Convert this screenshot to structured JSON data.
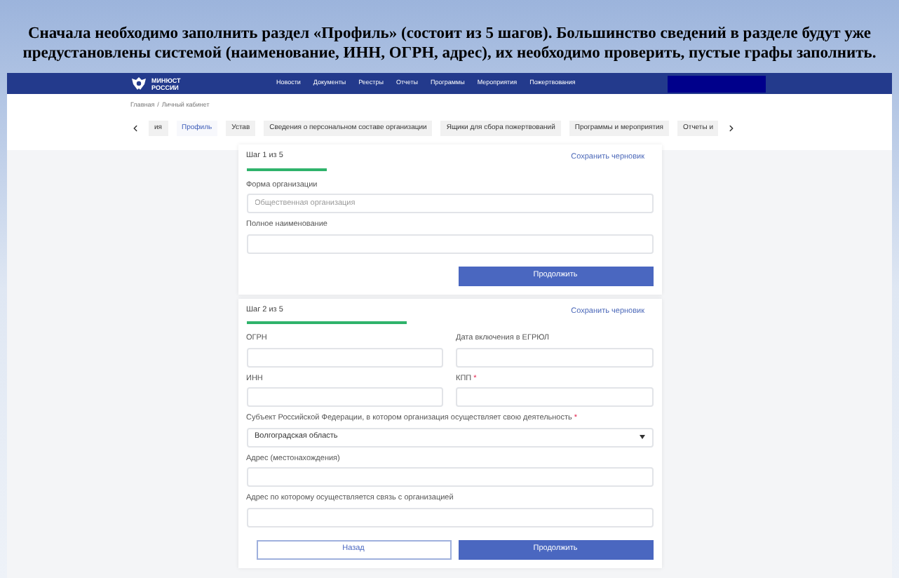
{
  "caption": "Сначала необходимо заполнить раздел «Профиль» (состоит из 5 шагов). Большинство сведений в разделе будут уже предустановлены системой (наименование, ИНН, ОГРН, адрес), их необходимо проверить, пустые графы заполнить.",
  "header": {
    "logo_lines": [
      "МИНЮСТ",
      "РОССИИ"
    ],
    "nav": [
      "Новости",
      "Документы",
      "Реестры",
      "Отчеты",
      "Программы",
      "Мероприятия",
      "Пожертвования"
    ]
  },
  "breadcrumb": {
    "items": [
      "Главная",
      "Личный кабинет"
    ],
    "separator": "/"
  },
  "tabs": [
    {
      "label": "ия",
      "selected": false
    },
    {
      "label": "Профиль",
      "selected": true
    },
    {
      "label": "Устав",
      "selected": false
    },
    {
      "label": "Сведения о персональном составе организации",
      "selected": false
    },
    {
      "label": "Ящики для сбора пожертвований",
      "selected": false
    },
    {
      "label": "Программы и мероприятия",
      "selected": false
    },
    {
      "label": "Отчеты и",
      "selected": false
    }
  ],
  "steps": [
    {
      "step_label": "Шаг 1 из 5",
      "save_label": "Сохранить черновик",
      "level": 0.2,
      "rows": [
        [
          {
            "kind": "text",
            "label": "Форма организации",
            "placeholder": "Общественная организация"
          }
        ],
        [
          {
            "kind": "text",
            "label": "Полное наименование"
          }
        ]
      ],
      "buttons": [
        {
          "kind": "primary",
          "label": "Продолжить"
        }
      ]
    },
    {
      "step_label": "Шаг 2 из 5",
      "save_label": "Сохранить черновик",
      "level": 0.4,
      "rows": [
        [
          {
            "kind": "text",
            "label": "ОГРН"
          },
          {
            "kind": "text",
            "label": "Дата включения в ЕГРЮЛ"
          }
        ],
        [
          {
            "kind": "text",
            "label": "ИНН"
          },
          {
            "kind": "text",
            "label": "КПП",
            "required_mark": "*"
          }
        ],
        [
          {
            "kind": "select",
            "label": "Субъект Российской Федерации, в котором организация осуществляет свою деятельность",
            "required_mark": "*",
            "value": "Волгоградская область"
          }
        ],
        [
          {
            "kind": "text",
            "label": "Адрес (местонахождения)"
          }
        ],
        [
          {
            "kind": "text",
            "label": "Адрес по которому осуществляется связь с организацией"
          }
        ]
      ],
      "buttons": [
        {
          "kind": "secondary",
          "label": "Назад"
        },
        {
          "kind": "primary",
          "label": "Продолжить"
        }
      ]
    }
  ]
}
